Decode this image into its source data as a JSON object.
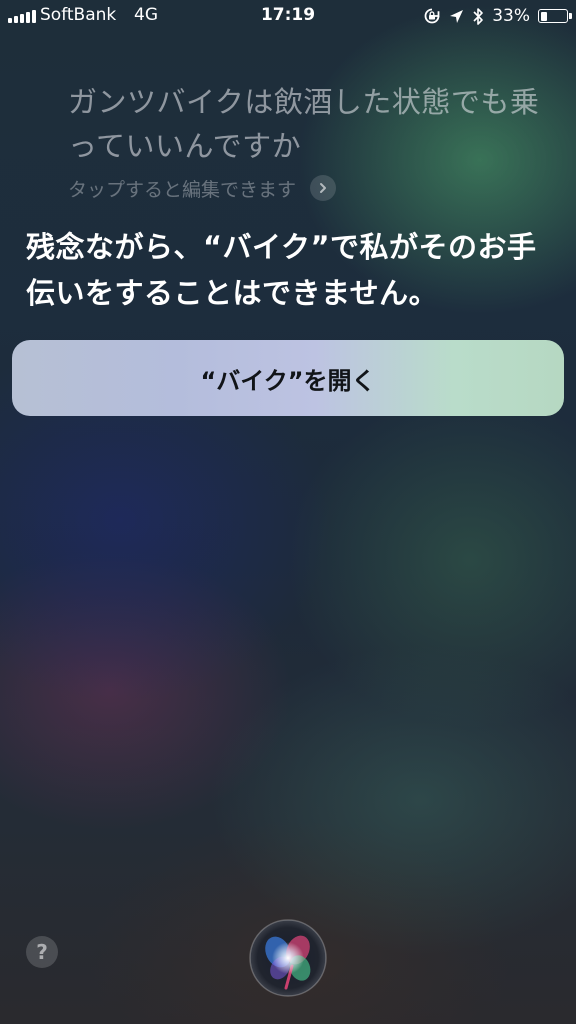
{
  "status_bar": {
    "carrier": "SoftBank",
    "network": "4G",
    "time": "17:19",
    "battery_percent": "33%",
    "battery_level": 0.33,
    "icons": [
      "signal-icon",
      "orientation-lock-icon",
      "location-arrow-icon",
      "bluetooth-icon",
      "battery-icon"
    ]
  },
  "siri": {
    "query": "ガンツバイクは飲酒した状態でも乗っていいんですか",
    "tap_to_edit": "タップすると編集できます",
    "response": "残念ながら、“バイク”で私がそのお手伝いをすることはできません。",
    "open_app_button": "“バイク”を開く",
    "help_label": "?"
  },
  "colors": {
    "button_gradient_start": "#b6c0d4",
    "button_gradient_end": "#b6d8c2",
    "query_text": "#e1e4e8",
    "response_text": "#ffffff"
  }
}
